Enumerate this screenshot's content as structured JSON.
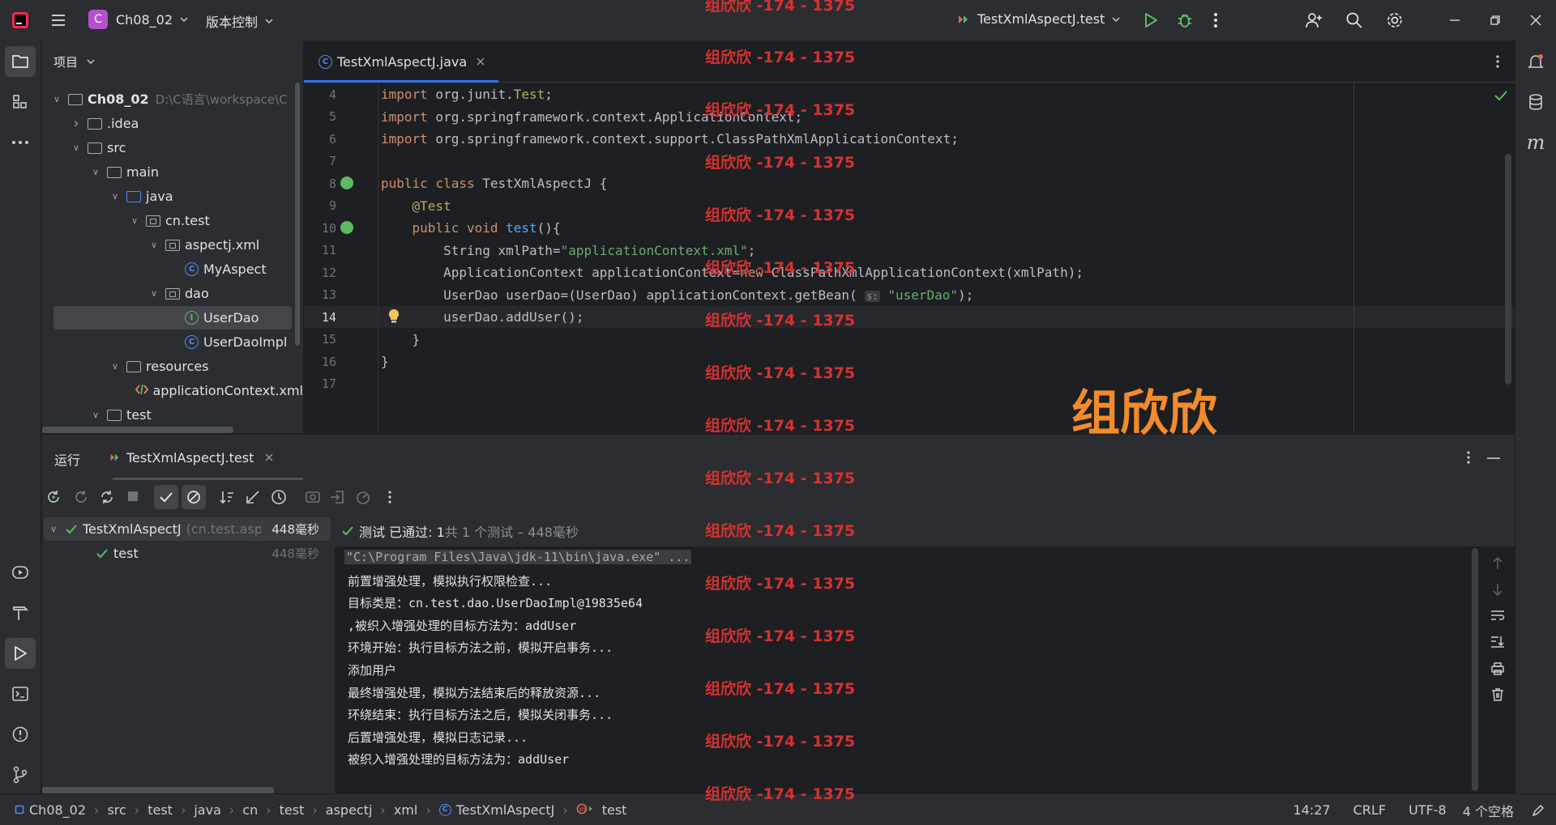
{
  "titlebar": {
    "project_badge": "C",
    "project_name": "Ch08_02",
    "vcs_label": "版本控制",
    "run_config": "TestXmlAspectJ.test"
  },
  "project_panel": {
    "title": "项目",
    "tree": [
      {
        "label": "Ch08_02",
        "path": "D:\\C语言\\workspace\\C",
        "chev": "open",
        "depth": 0,
        "kind": "module"
      },
      {
        "label": ".idea",
        "chev": "closed",
        "depth": 1,
        "kind": "folder"
      },
      {
        "label": "src",
        "chev": "open",
        "depth": 1,
        "kind": "folder"
      },
      {
        "label": "main",
        "chev": "open",
        "depth": 2,
        "kind": "folder"
      },
      {
        "label": "java",
        "chev": "open",
        "depth": 3,
        "kind": "folder-blue"
      },
      {
        "label": "cn.test",
        "chev": "open",
        "depth": 4,
        "kind": "package"
      },
      {
        "label": "aspectj.xml",
        "chev": "open",
        "depth": 5,
        "kind": "package"
      },
      {
        "label": "MyAspect",
        "chev": "",
        "depth": 6,
        "kind": "class"
      },
      {
        "label": "dao",
        "chev": "open",
        "depth": 5,
        "kind": "package"
      },
      {
        "label": "UserDao",
        "chev": "",
        "depth": 6,
        "kind": "interface",
        "selected": true
      },
      {
        "label": "UserDaoImpl",
        "chev": "",
        "depth": 6,
        "kind": "class"
      },
      {
        "label": "resources",
        "chev": "open",
        "depth": 3,
        "kind": "folder"
      },
      {
        "label": "applicationContext.xml",
        "chev": "",
        "depth": 4,
        "kind": "xml"
      },
      {
        "label": "test",
        "chev": "open",
        "depth": 2,
        "kind": "folder"
      }
    ]
  },
  "editor": {
    "tab_label": "TestXmlAspectJ.java",
    "lines": [
      {
        "n": "4",
        "html": "<span class='kw'>import</span> org.junit.<span class='ann'>Test</span>;"
      },
      {
        "n": "5",
        "html": "<span class='kw'>import</span> org.springframework.context.ApplicationContext;"
      },
      {
        "n": "6",
        "html": "<span class='kw'>import</span> org.springframework.context.support.ClassPathXmlApplicationContext;"
      },
      {
        "n": "7",
        "html": ""
      },
      {
        "n": "8",
        "html": "<span class='kw'>public class</span> TestXmlAspectJ {",
        "gutter": true
      },
      {
        "n": "9",
        "html": "    <span class='ann'>@Test</span>"
      },
      {
        "n": "10",
        "html": "    <span class='kw'>public void</span> <span class='fn'>test</span>(){",
        "gutter": true
      },
      {
        "n": "11",
        "html": "        String xmlPath=<span class='str'>\"applicationContext.xml\"</span>;"
      },
      {
        "n": "12",
        "html": "        ApplicationContext applicationContext=<span class='kw'>new</span> ClassPathXmlApplicationContext(xmlPath);"
      },
      {
        "n": "13",
        "html": "        UserDao userDao=(UserDao) applicationContext.getBean( <span style='color:#8c8f95;font-size:12px;background:#393b40;border-radius:3px;padding:0 2px'>s:</span> <span class='str'>\"userDao\"</span>);"
      },
      {
        "n": "14",
        "html": "        userDao.addUser();",
        "current": true,
        "bulb": true
      },
      {
        "n": "15",
        "html": "    }"
      },
      {
        "n": "16",
        "html": "}"
      },
      {
        "n": "17",
        "html": ""
      }
    ]
  },
  "run_panel": {
    "title": "运行",
    "tab_label": "TestXmlAspectJ.test",
    "tests": [
      {
        "name": "TestXmlAspectJ",
        "qualifier": "(cn.test.asp",
        "time": "448毫秒"
      },
      {
        "name": "test",
        "time": "448毫秒"
      }
    ],
    "status_pass": "测试 已通过: 1",
    "status_detail": "共 1 个测试 – 448毫秒",
    "console_lines": [
      "\"C:\\Program Files\\Java\\jdk-11\\bin\\java.exe\" ...",
      "前置增强处理，模拟执行权限检查...",
      "目标类是：cn.test.dao.UserDaoImpl@19835e64",
      ",被织入增强处理的目标方法为：addUser",
      "环境开始：执行目标方法之前，模拟开启事务...",
      "添加用户",
      "最终增强处理，模拟方法结束后的释放资源...",
      "环绕结束：执行目标方法之后，模拟关闭事务...",
      "后置增强处理，模拟日志记录...",
      "被织入增强处理的目标方法为：addUser"
    ]
  },
  "statusbar": {
    "breadcrumbs": [
      "Ch08_02",
      "src",
      "test",
      "java",
      "cn",
      "test",
      "aspectj",
      "xml",
      "TestXmlAspectJ",
      "test"
    ],
    "position": "14:27",
    "line_sep": "CRLF",
    "encoding": "UTF-8",
    "indent": "4 个空格"
  },
  "watermarks": {
    "repeat_text": "组欣欣 -174 - 1375",
    "big_text": "组欣欣"
  }
}
